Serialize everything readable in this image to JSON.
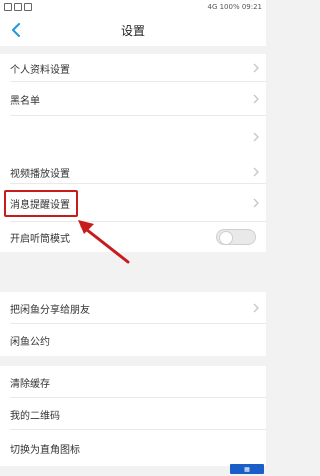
{
  "status_bar": {
    "left_icons": [
      "settings-icon",
      "image-icon",
      "video-icon"
    ],
    "right_text": "4G  100%  09:21"
  },
  "header": {
    "title": "设置"
  },
  "settings": {
    "group1": [
      {
        "label": "个人资料设置"
      },
      {
        "label": "黑名单"
      },
      {
        "label": ""
      }
    ],
    "group2": [
      {
        "label": "视频播放设置"
      },
      {
        "label": "消息提醒设置"
      },
      {
        "label": "开启听筒模式"
      }
    ],
    "group3": [
      {
        "label": "把闲鱼分享给朋友"
      },
      {
        "label": "闲鱼公约"
      }
    ],
    "group4": [
      {
        "label": "清除缓存"
      },
      {
        "label": "我的二维码"
      },
      {
        "label": "切换为直角图标"
      }
    ]
  },
  "colors": {
    "highlight": "#c81b1b",
    "background": "#f2f2f2",
    "row_background": "#ffffff"
  }
}
